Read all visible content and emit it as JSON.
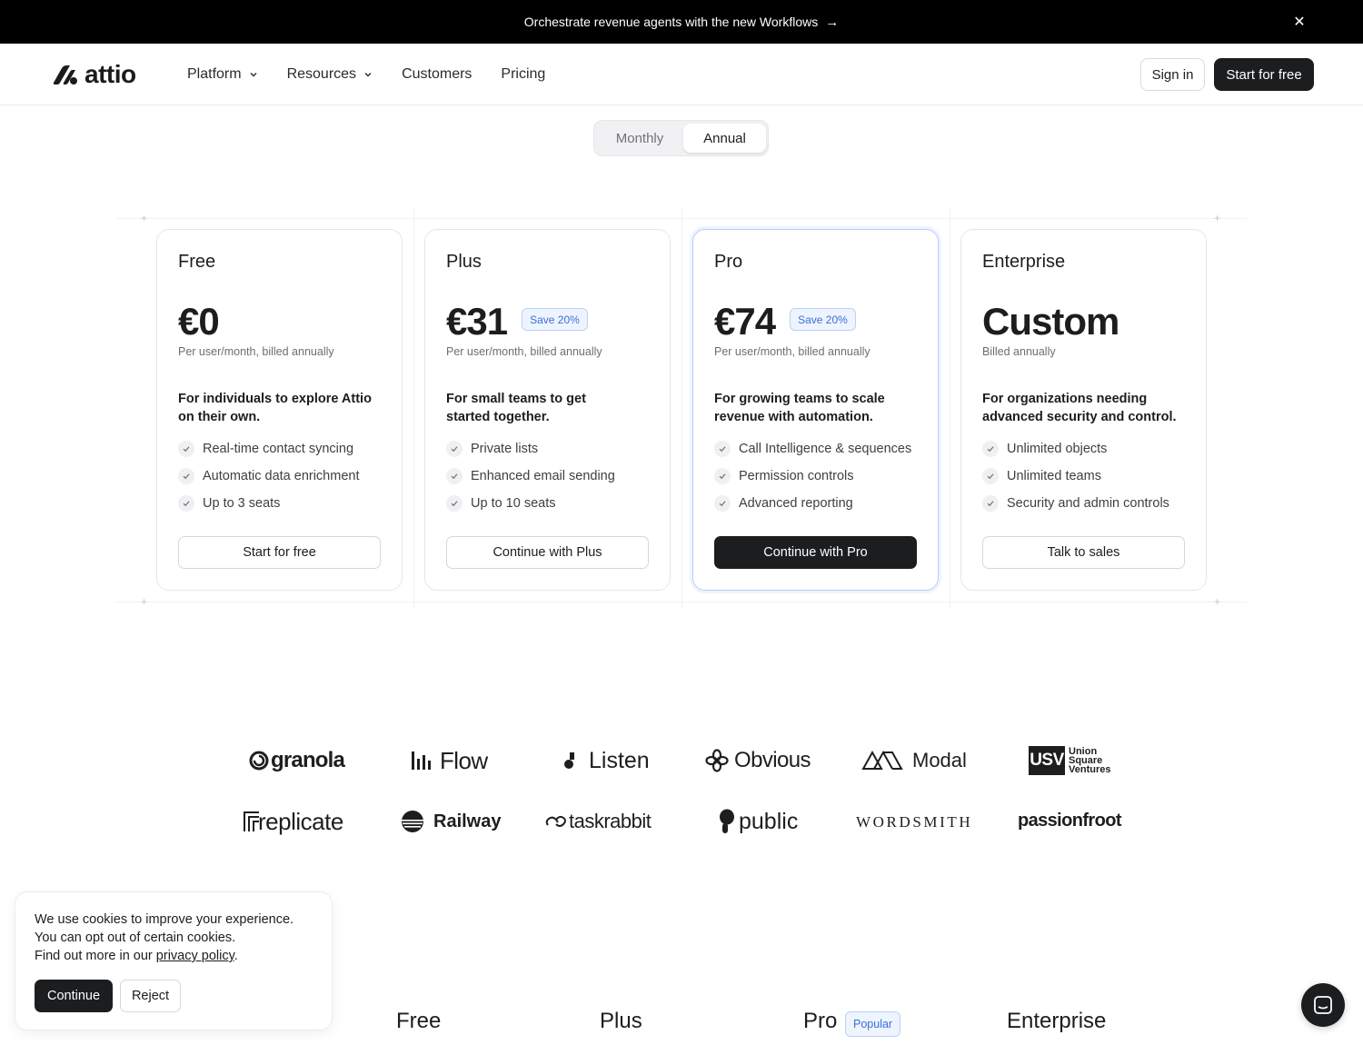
{
  "announcement": {
    "text": "Orchestrate revenue agents with the new Workflows",
    "arrow_icon": "arrow-right-icon",
    "close_icon": "close-icon"
  },
  "nav": {
    "brand": "attio",
    "links": [
      {
        "label": "Platform",
        "has_dropdown": true
      },
      {
        "label": "Resources",
        "has_dropdown": true
      },
      {
        "label": "Customers",
        "has_dropdown": false
      },
      {
        "label": "Pricing",
        "has_dropdown": false
      }
    ],
    "sign_in": "Sign in",
    "start_free": "Start for free"
  },
  "billing_toggle": {
    "options": [
      "Monthly",
      "Annual"
    ],
    "selected": "Annual"
  },
  "plans": [
    {
      "name": "Free",
      "price": "€0",
      "save_badge": "",
      "billed": "Per user/month, billed annually",
      "description": "For individuals to explore Attio on their own.",
      "features": [
        "Real-time contact syncing",
        "Automatic data enrichment",
        "Up to 3 seats"
      ],
      "cta": "Start for free"
    },
    {
      "name": "Plus",
      "price": "€31",
      "save_badge": "Save 20%",
      "billed": "Per user/month, billed annually",
      "description": "For small teams to get started together.",
      "features": [
        "Private lists",
        "Enhanced email sending",
        "Up to 10 seats"
      ],
      "cta": "Continue with Plus"
    },
    {
      "name": "Pro",
      "price": "€74",
      "save_badge": "Save 20%",
      "billed": "Per user/month, billed annually",
      "description": "For growing teams to scale revenue with automation.",
      "features": [
        "Call Intelligence & sequences",
        "Permission controls",
        "Advanced reporting"
      ],
      "cta": "Continue with Pro"
    },
    {
      "name": "Enterprise",
      "price": "Custom",
      "save_badge": "",
      "billed": "Billed annually",
      "description": "For organizations needing advanced security and control.",
      "features": [
        "Unlimited objects",
        "Unlimited teams",
        "Security and admin controls"
      ],
      "cta": "Talk to sales"
    }
  ],
  "customer_logos": {
    "row1": [
      "granola",
      "Flow",
      "Listen",
      "Obvious",
      "Modal",
      "USV"
    ],
    "usv_caption": [
      "Union",
      "Square",
      "Ventures"
    ],
    "row2": [
      "replicate",
      "Railway",
      "taskrabbit",
      "public",
      "WORDSMITH",
      "passionfroot"
    ]
  },
  "cookie_banner": {
    "line1": "We use cookies to improve your experience.",
    "line2": "You can opt out of certain cookies.",
    "line3_prefix": "Find out more in our ",
    "link": "privacy policy",
    "line3_suffix": ".",
    "continue": "Continue",
    "reject": "Reject"
  },
  "comparison_headers": {
    "plans": [
      "Free",
      "Plus",
      "Pro",
      "Enterprise"
    ],
    "popular_badge": "Popular"
  },
  "colors": {
    "accent_blue": "#3b6fd4",
    "dark": "#1c1d1f",
    "badge_bg": "#eef4fe"
  }
}
